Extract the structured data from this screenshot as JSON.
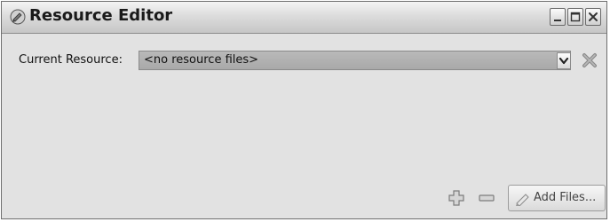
{
  "window": {
    "title": "Resource Editor",
    "app_icon": "resource-editor-icon",
    "controls": {
      "minimize": "minimize-icon",
      "maximize": "maximize-icon",
      "close": "close-icon"
    }
  },
  "resource_row": {
    "label": "Current Resource:",
    "selected_value": "<no resource files>",
    "dropdown_icon": "chevron-down-icon",
    "delete_icon": "delete-x-icon"
  },
  "footer": {
    "add_icon": "plus-icon",
    "remove_icon": "minus-icon",
    "add_files_label": "Add Files...",
    "add_files_icon": "pencil-icon"
  },
  "colors": {
    "window_background": "#e2e2e2",
    "combo_background": "#b0b0b0",
    "titlebar_top": "#f4f4f4",
    "titlebar_bottom": "#c6c6c6"
  }
}
